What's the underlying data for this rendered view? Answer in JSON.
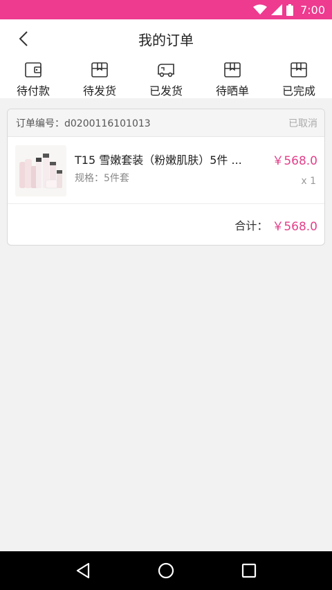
{
  "status_bar": {
    "time": "7:00",
    "icons": [
      "wifi-icon",
      "signal-icon",
      "battery-icon"
    ]
  },
  "header": {
    "title": "我的订单",
    "back_icon": "chevron-left-icon"
  },
  "tabs": [
    {
      "label": "待付款",
      "icon": "wallet-icon"
    },
    {
      "label": "待发货",
      "icon": "package-icon"
    },
    {
      "label": "已发货",
      "icon": "truck-icon"
    },
    {
      "label": "待晒单",
      "icon": "package-icon"
    },
    {
      "label": "已完成",
      "icon": "package-icon"
    }
  ],
  "order": {
    "number_label": "订单编号：d0200116101013",
    "status": "已取消",
    "item": {
      "name": "T15 雪嫩套装（粉嫩肌肤）5件 ...",
      "spec": "规格：5件套",
      "price": "￥568.0",
      "qty": "x 1"
    },
    "total_label": "合计：",
    "total_value": "￥568.0"
  },
  "colors": {
    "accent": "#ee3a8f",
    "price": "#e2408a",
    "background": "#f2f2f2"
  },
  "nav": [
    "back-triangle-icon",
    "home-circle-icon",
    "recents-square-icon"
  ]
}
